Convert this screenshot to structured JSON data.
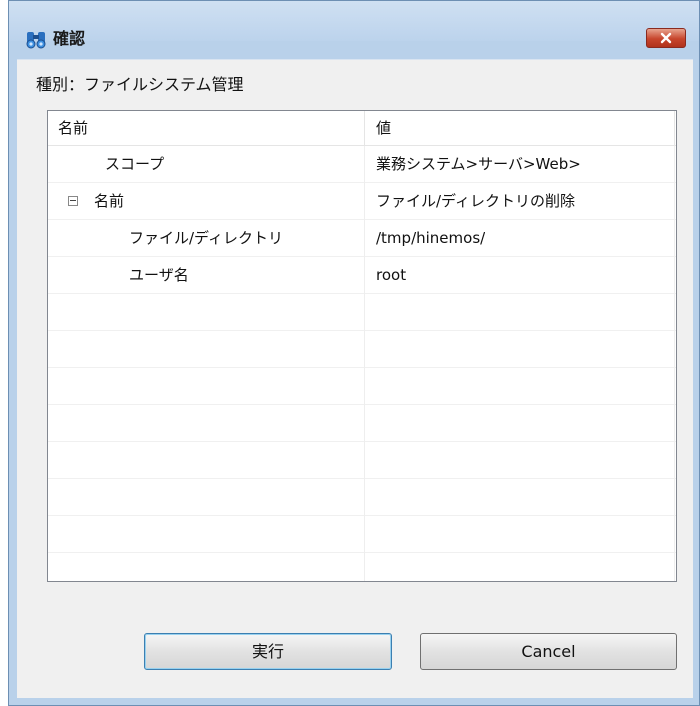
{
  "window": {
    "title": "確認"
  },
  "header": {
    "type_label": "種別：ファイルシステム管理"
  },
  "table": {
    "columns": [
      "名前",
      "値"
    ],
    "rows": [
      {
        "name": "スコープ",
        "value": "業務システム>サーバ>Web>",
        "level": 1
      },
      {
        "name": "名前",
        "value": "ファイル/ディレクトリの削除",
        "level": 0,
        "expanded": true
      },
      {
        "name": "ファイル/ディレクトリ",
        "value": "/tmp/hinemos/",
        "level": 2
      },
      {
        "name": "ユーザ名",
        "value": "root",
        "level": 2
      },
      {
        "name": "",
        "value": ""
      },
      {
        "name": "",
        "value": ""
      },
      {
        "name": "",
        "value": ""
      },
      {
        "name": "",
        "value": ""
      },
      {
        "name": "",
        "value": ""
      },
      {
        "name": "",
        "value": ""
      },
      {
        "name": "",
        "value": ""
      },
      {
        "name": "",
        "value": ""
      }
    ]
  },
  "buttons": {
    "execute": "実行",
    "cancel": "Cancel"
  },
  "icons": {
    "app": "binoculars-icon",
    "close": "close-icon"
  },
  "colors": {
    "title_bar": "#bcd3ec",
    "close_button": "#c7452c",
    "default_button_border": "#3c7fb1"
  }
}
